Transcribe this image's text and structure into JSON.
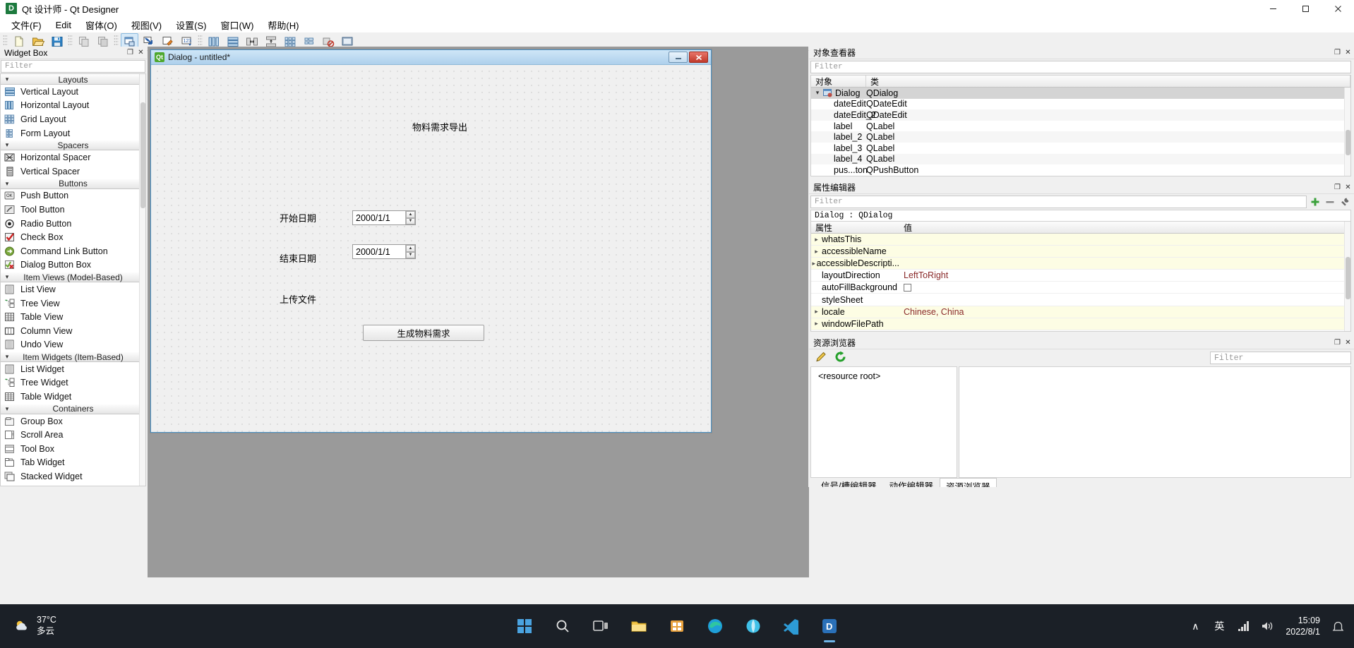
{
  "window": {
    "title": "Qt 设计师 - Qt Designer",
    "app_icon": "D",
    "minimize": "—",
    "maximize": "❐",
    "close": "✕"
  },
  "menubar": {
    "items": [
      {
        "label": "文件(F)",
        "name": "menu-file"
      },
      {
        "label": "Edit",
        "name": "menu-edit"
      },
      {
        "label": "窗体(O)",
        "name": "menu-form"
      },
      {
        "label": "视图(V)",
        "name": "menu-view"
      },
      {
        "label": "设置(S)",
        "name": "menu-settings"
      },
      {
        "label": "窗口(W)",
        "name": "menu-window"
      },
      {
        "label": "帮助(H)",
        "name": "menu-help"
      }
    ]
  },
  "toolbar": {
    "groups": [
      [
        "new-file-icon",
        "open-file-icon",
        "save-file-icon"
      ],
      [
        "undo-icon",
        "redo-icon"
      ],
      [
        "edit-widgets-icon",
        "edit-signals-slots-icon",
        "edit-buddies-icon",
        "edit-tab-order-icon"
      ],
      [
        "layout-horizontally-icon",
        "layout-vertically-icon",
        "layout-splitter-h-icon",
        "layout-splitter-v-icon",
        "layout-grid-icon",
        "layout-form-icon",
        "break-layout-icon",
        "adjust-size-icon"
      ]
    ]
  },
  "widget_box": {
    "title": "Widget Box",
    "float_btn": "❐",
    "close_btn": "✕",
    "filter_placeholder": "Filter",
    "categories": [
      {
        "name": "Layouts",
        "items": [
          {
            "label": "Vertical Layout",
            "icon": "vertical-layout-icon"
          },
          {
            "label": "Horizontal Layout",
            "icon": "horizontal-layout-icon"
          },
          {
            "label": "Grid Layout",
            "icon": "grid-layout-icon"
          },
          {
            "label": "Form Layout",
            "icon": "form-layout-icon"
          }
        ]
      },
      {
        "name": "Spacers",
        "items": [
          {
            "label": "Horizontal Spacer",
            "icon": "horizontal-spacer-icon"
          },
          {
            "label": "Vertical Spacer",
            "icon": "vertical-spacer-icon"
          }
        ]
      },
      {
        "name": "Buttons",
        "items": [
          {
            "label": "Push Button",
            "icon": "push-button-icon"
          },
          {
            "label": "Tool Button",
            "icon": "tool-button-icon"
          },
          {
            "label": "Radio Button",
            "icon": "radio-button-icon"
          },
          {
            "label": "Check Box",
            "icon": "check-box-icon"
          },
          {
            "label": "Command Link Button",
            "icon": "command-link-button-icon"
          },
          {
            "label": "Dialog Button Box",
            "icon": "dialog-button-box-icon"
          }
        ]
      },
      {
        "name": "Item Views (Model-Based)",
        "items": [
          {
            "label": "List View",
            "icon": "list-view-icon"
          },
          {
            "label": "Tree View",
            "icon": "tree-view-icon"
          },
          {
            "label": "Table View",
            "icon": "table-view-icon"
          },
          {
            "label": "Column View",
            "icon": "column-view-icon"
          },
          {
            "label": "Undo View",
            "icon": "undo-view-icon"
          }
        ]
      },
      {
        "name": "Item Widgets (Item-Based)",
        "items": [
          {
            "label": "List Widget",
            "icon": "list-widget-icon"
          },
          {
            "label": "Tree Widget",
            "icon": "tree-widget-icon"
          },
          {
            "label": "Table Widget",
            "icon": "table-widget-icon"
          }
        ]
      },
      {
        "name": "Containers",
        "items": [
          {
            "label": "Group Box",
            "icon": "group-box-icon"
          },
          {
            "label": "Scroll Area",
            "icon": "scroll-area-icon"
          },
          {
            "label": "Tool Box",
            "icon": "tool-box-icon"
          },
          {
            "label": "Tab Widget",
            "icon": "tab-widget-icon"
          },
          {
            "label": "Stacked Widget",
            "icon": "stacked-widget-icon"
          }
        ]
      }
    ]
  },
  "form": {
    "titlebar": {
      "icon": "Qt",
      "title": "Dialog - untitled*",
      "minimize": "—",
      "close": "✕"
    },
    "widgets": {
      "heading": "物料需求导出",
      "start_date_label": "开始日期",
      "start_date_value": "2000/1/1",
      "end_date_label": "结束日期",
      "end_date_value": "2000/1/1",
      "upload_file_label": "上传文件",
      "generate_button": "生成物料需求"
    }
  },
  "object_inspector": {
    "title": "对象查看器",
    "float_btn": "❐",
    "close_btn": "✕",
    "filter_placeholder": "Filter",
    "columns": [
      "对象",
      "类"
    ],
    "rows": [
      {
        "name": "Dialog",
        "class": "QDialog",
        "level": 0,
        "expanded": true,
        "selected": true,
        "icon": "qdialog-icon"
      },
      {
        "name": "dateEdit",
        "class": "QDateEdit",
        "level": 1,
        "selected": false
      },
      {
        "name": "dateEdit_2",
        "class": "QDateEdit",
        "level": 1,
        "selected": false
      },
      {
        "name": "label",
        "class": "QLabel",
        "level": 1,
        "selected": false
      },
      {
        "name": "label_2",
        "class": "QLabel",
        "level": 1,
        "selected": false
      },
      {
        "name": "label_3",
        "class": "QLabel",
        "level": 1,
        "selected": false
      },
      {
        "name": "label_4",
        "class": "QLabel",
        "level": 1,
        "selected": false
      },
      {
        "name": "pus...ton",
        "class": "QPushButton",
        "level": 1,
        "selected": false
      }
    ]
  },
  "property_editor": {
    "title": "属性编辑器",
    "float_btn": "❐",
    "close_btn": "✕",
    "filter_placeholder": "Filter",
    "object_line": "Dialog : QDialog",
    "columns": [
      "属性",
      "值"
    ],
    "add_icon": "plus-icon",
    "remove_icon": "minus-icon",
    "config_icon": "wrench-icon",
    "rows": [
      {
        "name": "whatsThis",
        "value": "",
        "expandable": true
      },
      {
        "name": "accessibleName",
        "value": "",
        "expandable": true
      },
      {
        "name": "accessibleDescripti...",
        "value": "",
        "expandable": true
      },
      {
        "name": "layoutDirection",
        "value": "LeftToRight",
        "expandable": false
      },
      {
        "name": "autoFillBackground",
        "value": "",
        "expandable": false,
        "checkbox": true
      },
      {
        "name": "styleSheet",
        "value": "",
        "expandable": false
      },
      {
        "name": "locale",
        "value": "Chinese, China",
        "expandable": true
      },
      {
        "name": "windowFilePath",
        "value": "",
        "expandable": true
      }
    ]
  },
  "resource_browser": {
    "title": "资源浏览器",
    "float_btn": "❐",
    "close_btn": "✕",
    "edit_icon": "pencil-icon",
    "reload_icon": "reload-icon",
    "filter_placeholder": "Filter",
    "root_label": "<resource root>",
    "tabs": [
      {
        "label": "信号/槽编辑器",
        "active": false
      },
      {
        "label": "动作编辑器",
        "active": false
      },
      {
        "label": "资源浏览器",
        "active": true
      }
    ]
  },
  "taskbar": {
    "weather_temp": "37°C",
    "weather_desc": "多云",
    "weather_icon": "partly-cloudy-icon",
    "apps": [
      {
        "name": "start-button",
        "icon": "windows-icon"
      },
      {
        "name": "search-button",
        "icon": "search-icon"
      },
      {
        "name": "task-view-button",
        "icon": "task-view-icon"
      },
      {
        "name": "file-explorer-button",
        "icon": "folder-icon"
      },
      {
        "name": "store-button",
        "icon": "store-icon"
      },
      {
        "name": "edge-button",
        "icon": "edge-icon"
      },
      {
        "name": "browser-button",
        "icon": "browser-icon"
      },
      {
        "name": "vscode-button",
        "icon": "vscode-icon"
      },
      {
        "name": "qt-designer-button",
        "icon": "designer-icon"
      }
    ],
    "tray": {
      "chevron": "∧",
      "ime": "英",
      "network_icon": "network-icon",
      "volume_icon": "volume-icon",
      "time": "15:09",
      "date": "2022/8/1",
      "notification_icon": "notification-icon"
    }
  },
  "colors": {
    "accent": "#4b93c7",
    "titlebar_gradient_top": "#cfe6f7",
    "property_row_bg": "#fdfde4",
    "taskbar": "#1b2027"
  }
}
